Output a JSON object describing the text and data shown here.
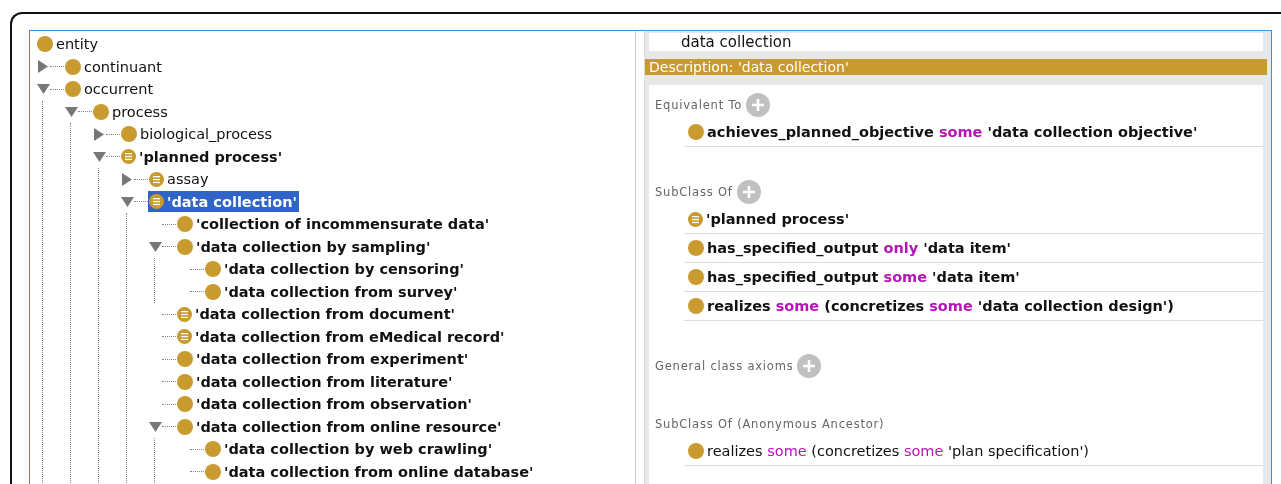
{
  "tree": [
    {
      "label": "entity",
      "kind": "primitive",
      "bold": false,
      "selected": false,
      "children": [
        {
          "label": "continuant",
          "kind": "primitive",
          "bold": false,
          "selected": false,
          "expanded": false
        },
        {
          "label": "occurrent",
          "kind": "primitive",
          "bold": false,
          "selected": false,
          "expanded": true,
          "children": [
            {
              "label": "process",
              "kind": "primitive",
              "bold": false,
              "selected": false,
              "expanded": true,
              "children": [
                {
                  "label": "biological_process",
                  "kind": "primitive",
                  "bold": false,
                  "selected": false,
                  "expanded": false
                },
                {
                  "label": "'planned process'",
                  "kind": "defined",
                  "bold": true,
                  "selected": false,
                  "expanded": true,
                  "children": [
                    {
                      "label": "assay",
                      "kind": "defined",
                      "bold": false,
                      "selected": false,
                      "expanded": false
                    },
                    {
                      "label": "'data collection'",
                      "kind": "defined",
                      "bold": true,
                      "selected": true,
                      "expanded": true,
                      "children": [
                        {
                          "label": "'collection of incommensurate data'",
                          "kind": "primitive",
                          "bold": true,
                          "selected": false
                        },
                        {
                          "label": "'data collection by sampling'",
                          "kind": "primitive",
                          "bold": true,
                          "selected": false,
                          "expanded": true,
                          "children": [
                            {
                              "label": "'data collection by censoring'",
                              "kind": "primitive",
                              "bold": true,
                              "selected": false
                            },
                            {
                              "label": "'data collection from survey'",
                              "kind": "primitive",
                              "bold": true,
                              "selected": false
                            }
                          ]
                        },
                        {
                          "label": "'data collection from document'",
                          "kind": "defined",
                          "bold": true,
                          "selected": false
                        },
                        {
                          "label": "'data collection from eMedical record'",
                          "kind": "defined",
                          "bold": true,
                          "selected": false
                        },
                        {
                          "label": "'data collection from experiment'",
                          "kind": "primitive",
                          "bold": true,
                          "selected": false
                        },
                        {
                          "label": "'data collection from literature'",
                          "kind": "primitive",
                          "bold": true,
                          "selected": false
                        },
                        {
                          "label": "'data collection from observation'",
                          "kind": "primitive",
                          "bold": true,
                          "selected": false
                        },
                        {
                          "label": "'data collection from online resource'",
                          "kind": "primitive",
                          "bold": true,
                          "selected": false,
                          "expanded": true,
                          "children": [
                            {
                              "label": "'data collection by web crawling'",
                              "kind": "primitive",
                              "bold": true,
                              "selected": false
                            },
                            {
                              "label": "'data collection from online database'",
                              "kind": "primitive",
                              "bold": true,
                              "selected": false
                            }
                          ]
                        }
                      ]
                    }
                  ]
                }
              ]
            }
          ]
        }
      ]
    }
  ],
  "entity_name": "data collection",
  "description_header": "Description: 'data collection'",
  "sections": [
    {
      "title": "Equivalent To",
      "add_button": true,
      "items": [
        {
          "kind": "primitive",
          "bold": true,
          "segments": [
            {
              "kind": "name",
              "text": "achieves_planned_objective "
            },
            {
              "kind": "keyword",
              "text": "some"
            },
            {
              "kind": "name",
              "text": " 'data collection objective'"
            }
          ]
        }
      ]
    },
    {
      "title": "SubClass Of",
      "add_button": true,
      "items": [
        {
          "kind": "defined",
          "bold": true,
          "segments": [
            {
              "kind": "name",
              "text": "'planned process'"
            }
          ]
        },
        {
          "kind": "primitive",
          "bold": true,
          "segments": [
            {
              "kind": "name",
              "text": "has_specified_output "
            },
            {
              "kind": "keyword",
              "text": "only"
            },
            {
              "kind": "name",
              "text": " 'data item'"
            }
          ]
        },
        {
          "kind": "primitive",
          "bold": true,
          "segments": [
            {
              "kind": "name",
              "text": "has_specified_output "
            },
            {
              "kind": "keyword",
              "text": "some"
            },
            {
              "kind": "name",
              "text": " 'data item'"
            }
          ]
        },
        {
          "kind": "primitive",
          "bold": true,
          "segments": [
            {
              "kind": "name",
              "text": "realizes "
            },
            {
              "kind": "keyword",
              "text": "some"
            },
            {
              "kind": "name",
              "text": " (concretizes "
            },
            {
              "kind": "keyword",
              "text": "some"
            },
            {
              "kind": "name",
              "text": " 'data collection design')"
            }
          ]
        }
      ]
    },
    {
      "title": "General class axioms",
      "add_button": true
    },
    {
      "title": "SubClass Of (Anonymous Ancestor)",
      "items": [
        {
          "kind": "primitive",
          "bold": false,
          "segments": [
            {
              "kind": "name",
              "text": "realizes "
            },
            {
              "kind": "keyword",
              "text": "some"
            },
            {
              "kind": "name",
              "text": " (concretizes "
            },
            {
              "kind": "keyword",
              "text": "some"
            },
            {
              "kind": "name",
              "text": " 'plan specification')"
            }
          ]
        }
      ]
    }
  ]
}
